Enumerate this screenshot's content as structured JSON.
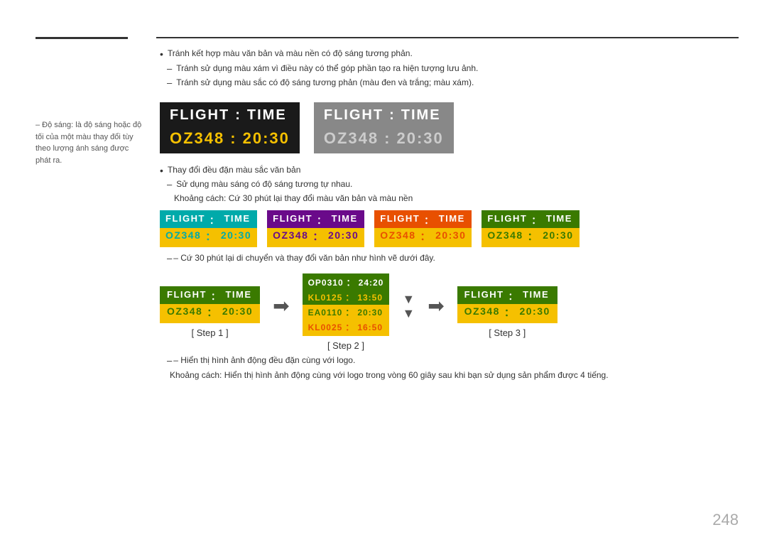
{
  "page": {
    "number": "248"
  },
  "sidebar": {
    "text": "– Độ sáng: là độ sáng hoặc độ tối của một màu thay đổi tùy theo lượng ánh sáng được phát ra."
  },
  "main": {
    "bullet1": "Tránh kết hợp màu văn bản và màu nền có độ sáng tương phản.",
    "dash1": "Tránh sử dụng màu xám vì điều này có thể góp phần tạo ra hiện tượng lưu ảnh.",
    "dash2": "Tránh sử dụng màu sắc có độ sáng tương phản (màu đen và trắng; màu xám).",
    "flight_label_top": "FLIGHT",
    "flight_colon": ":",
    "flight_label_time": "TIME",
    "flight_code": "OZ348",
    "flight_time": "20:30",
    "bullet2": "Thay đổi đều đặn màu sắc văn bản",
    "dash3": "Sử dụng màu sáng có độ sáng tương tự nhau.",
    "dash4": "Khoảng cách: Cứ 30 phút lại thay đổi màu văn bản và màu nền",
    "note_move": "– Cứ 30 phút lại di chuyển và thay đổi văn bản như hình vẽ dưới đây.",
    "step1_label": "[ Step 1 ]",
    "step2_label": "[ Step 2 ]",
    "step3_label": "[ Step 3 ]",
    "step2_rows": [
      {
        "code": "OP0310",
        "colon": ":",
        "time": "24:20"
      },
      {
        "code": "KL0125",
        "colon": ":",
        "time": "13:50"
      },
      {
        "code": "EA0110",
        "colon": ":",
        "time": "20:30"
      },
      {
        "code": "KL0025",
        "colon": ":",
        "time": "16:50"
      }
    ],
    "note_logo1": "– Hiển thị hình ảnh động đều đặn cùng với logo.",
    "note_logo2": "Khoảng cách: Hiển thị hình ảnh động cùng với logo trong vòng 60 giây sau khi bạn sử dụng sản phẩm được 4 tiếng."
  }
}
